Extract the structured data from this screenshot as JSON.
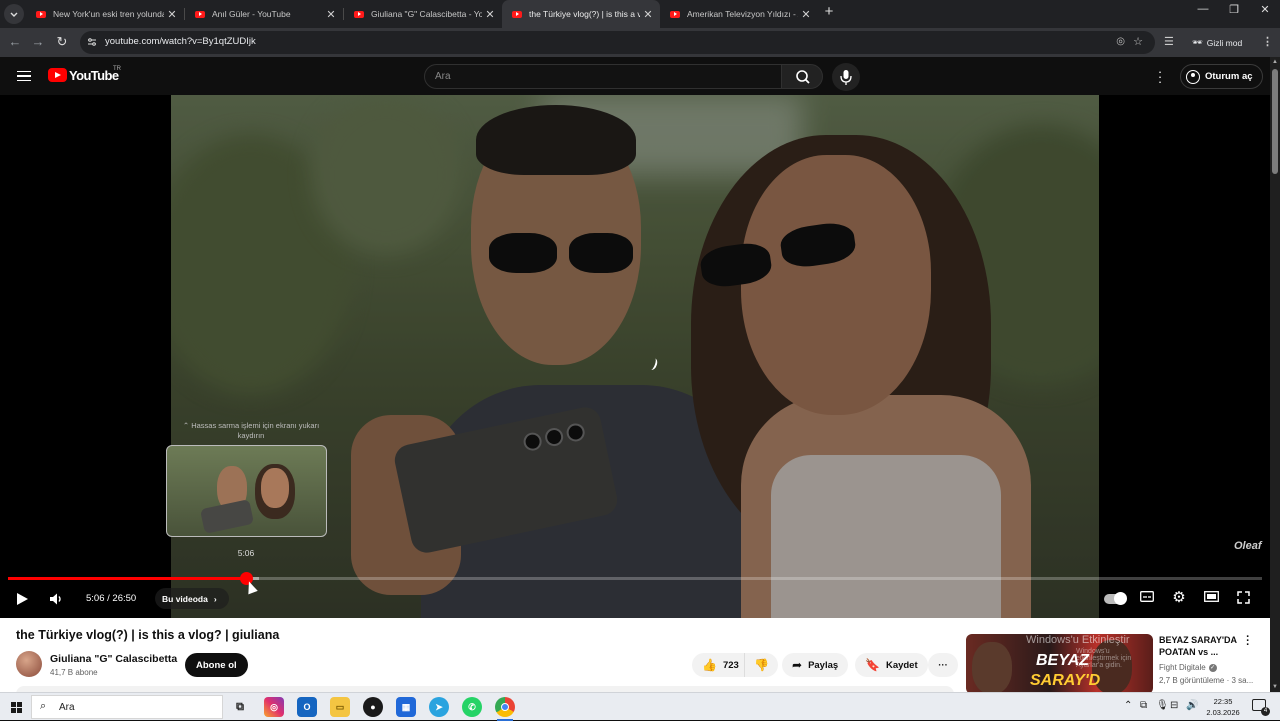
{
  "browser": {
    "tabs": [
      {
        "label": "New York'un eski tren yolunda",
        "active": false
      },
      {
        "label": "Anıl Güler - YouTube",
        "active": false
      },
      {
        "label": "Giuliana \"G\" Calascibetta - You",
        "active": false
      },
      {
        "label": "the Türkiye vlog(?) | is this a vlo",
        "active": true
      },
      {
        "label": "Amerikan Televizyon Yıldızı - Ay",
        "active": false
      }
    ],
    "url": "youtube.com/watch?v=By1qtZUDIjk",
    "incognito_label": "Gizli mod"
  },
  "masthead": {
    "logo_text": "YouTube",
    "country_code": "TR",
    "search_placeholder": "Ara",
    "signin_label": "Oturum aç"
  },
  "player": {
    "seek_hint": "Hassas sarma işlemi için ekranı yukarı kaydırın",
    "preview_time": "5:06",
    "current_time": "5:06",
    "duration": "26:50",
    "time_display": "5:06 / 26:50",
    "chapter_label": "Bu videoda",
    "played_fraction": 0.19,
    "buffered_fraction": 0.2,
    "watermark": "Oleaf"
  },
  "video": {
    "title": "the Türkiye vlog(?) | is this a vlog? | giuliana",
    "channel_name": "Giuliana \"G\" Calascibetta",
    "subscribers": "41,7 B abone",
    "subscribe_label": "Abone ol",
    "like_count": "723",
    "share_label": "Paylaş",
    "save_label": "Kaydet"
  },
  "recommendation": {
    "title": "BEYAZ SARAY'DA POATAN vs ...",
    "channel": "Fight Digitale",
    "views": "2,7 B görüntüleme · 3 sa...",
    "thumb_text_1": "BEYAZ",
    "thumb_text_2": "SARAY'D",
    "overlay_text_1": "Windows'u Etkinleştir",
    "overlay_text_2": "Windows'u etkinleştirmek için Ayarlar'a gidin."
  },
  "taskbar": {
    "search_placeholder": "Ara",
    "time": "22:35",
    "date": "2.03.2026",
    "notification_count": "4"
  },
  "colors": {
    "youtube_red": "#ff0000",
    "player_bg": "#000000",
    "page_bg": "#ffffff",
    "chrome_dark": "#202124",
    "chrome_toolbar": "#35363a"
  }
}
